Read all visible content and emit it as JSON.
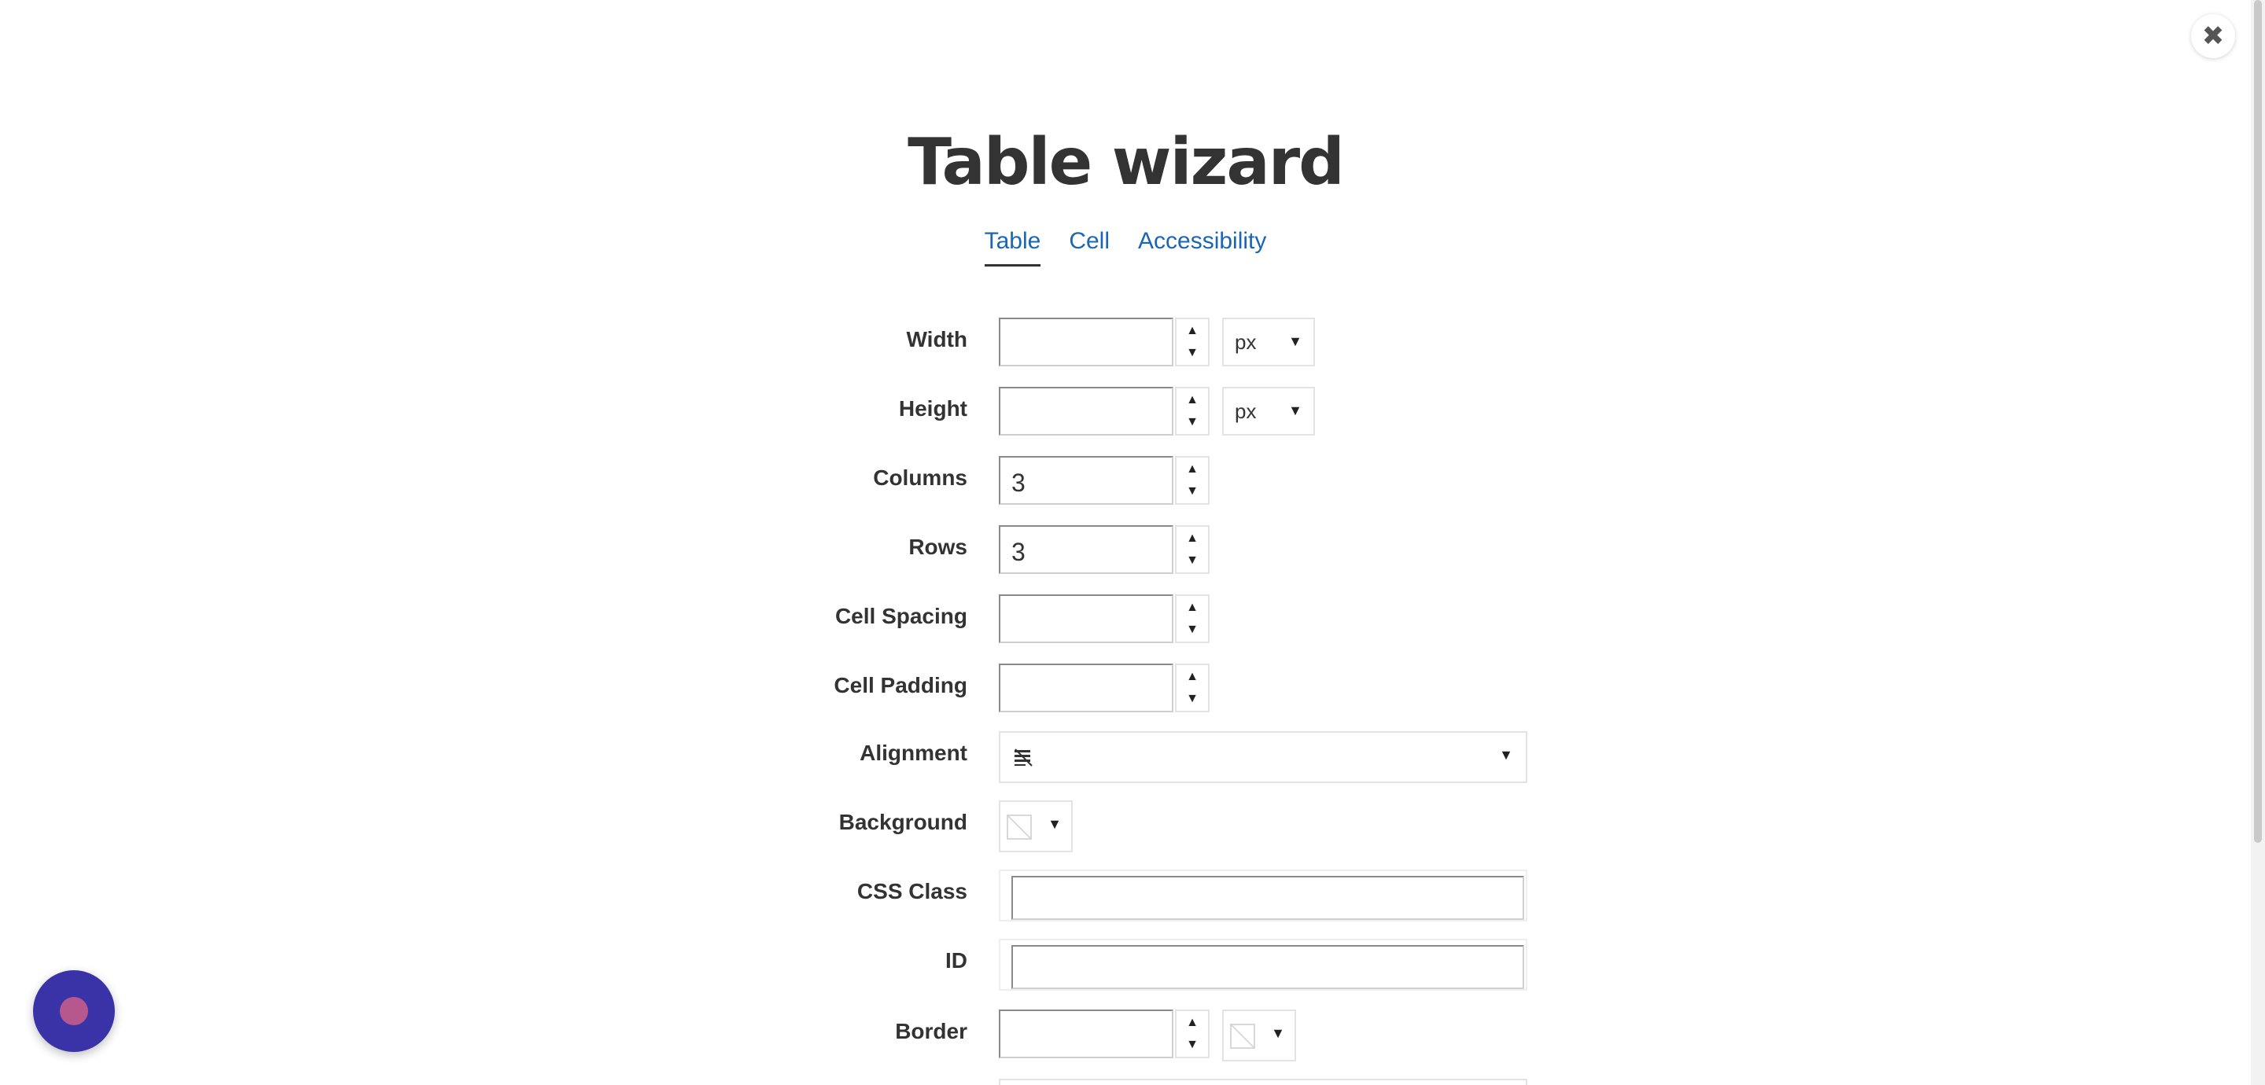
{
  "dialog": {
    "title": "Table wizard",
    "close_icon": "close-icon",
    "close_glyph": "✖"
  },
  "tabs": [
    {
      "label": "Table",
      "active": true
    },
    {
      "label": "Cell",
      "active": false
    },
    {
      "label": "Accessibility",
      "active": false
    }
  ],
  "fields": {
    "width": {
      "label": "Width",
      "value": "",
      "unit": "px"
    },
    "height": {
      "label": "Height",
      "value": "",
      "unit": "px"
    },
    "columns": {
      "label": "Columns",
      "value": "3"
    },
    "rows": {
      "label": "Rows",
      "value": "3"
    },
    "cell_spacing": {
      "label": "Cell Spacing",
      "value": ""
    },
    "cell_padding": {
      "label": "Cell Padding",
      "value": ""
    },
    "alignment": {
      "label": "Alignment",
      "icon": "align-none-icon"
    },
    "background": {
      "label": "Background",
      "icon": "no-color-icon"
    },
    "css_class": {
      "label": "CSS Class",
      "value": ""
    },
    "id": {
      "label": "ID",
      "value": ""
    },
    "border": {
      "label": "Border",
      "value": "",
      "color_icon": "no-color-icon"
    }
  },
  "glyphs": {
    "up": "▲",
    "down": "▼",
    "caret": "▼"
  },
  "colors": {
    "link": "#1a66b3",
    "launcher": "#3a33a8",
    "launcher_dot": "#b6578e"
  }
}
